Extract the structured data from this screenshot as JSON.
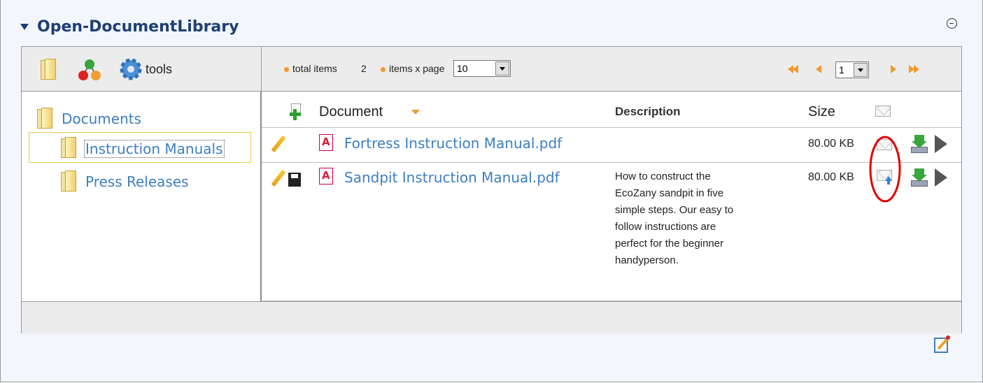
{
  "portlet": {
    "title": "Open-DocumentLibrary"
  },
  "toolbar": {
    "tools_label": "tools",
    "total_items_label": "total items",
    "total_items": "2",
    "items_per_page_label": "items x page",
    "items_per_page": "10",
    "page": "1"
  },
  "tree": {
    "root": "Documents",
    "children": [
      "Instruction Manuals",
      "Press Releases"
    ],
    "selected": "Instruction Manuals"
  },
  "table": {
    "columns": {
      "document": "Document",
      "description": "Description",
      "size": "Size"
    },
    "sort_column": "Document",
    "rows": [
      {
        "name": "Fortress Instruction Manual.pdf",
        "description": "",
        "size": "80.00 KB",
        "locked": false,
        "subscribed": false
      },
      {
        "name": "Sandpit Instruction Manual.pdf",
        "description_lines": [
          "How to construct the",
          "EcoZany sandpit in five",
          "simple steps. Our easy to",
          "follow instructions are",
          "perfect for the beginner",
          "handyperson."
        ],
        "size": "80.00 KB",
        "locked": true,
        "subscribed": true
      }
    ]
  },
  "highlight": {
    "color": "#e00000",
    "target": "subscribe-icon"
  },
  "colors": {
    "accent": "#f39a2c",
    "link": "#3d7fc1",
    "title": "#1f3f74"
  }
}
